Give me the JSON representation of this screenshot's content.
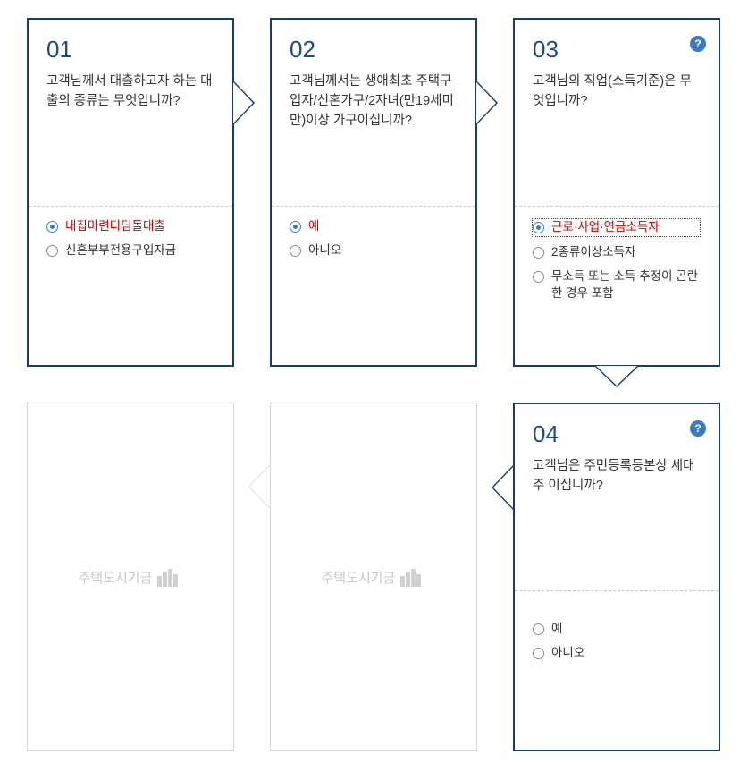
{
  "cards": [
    {
      "num": "01",
      "question": "고객님께서 대출하고자 하는 대출의 종류는 무엇입니까?",
      "options": [
        {
          "label": "내집마련디딤돌대출",
          "selected": true
        },
        {
          "label": "신혼부부전용구입자금",
          "selected": false
        }
      ]
    },
    {
      "num": "02",
      "question": "고객님께서는 생애최초 주택구입자/신혼가구/2자녀(만19세미만)이상 가구이십니까?",
      "options": [
        {
          "label": "예",
          "selected": true
        },
        {
          "label": "아니오",
          "selected": false
        }
      ]
    },
    {
      "num": "03",
      "question": "고객님의 직업(소득기준)은 무엇입니까?",
      "help": true,
      "options": [
        {
          "label": "근로·사업·연금소득자",
          "selected": true,
          "focused": true
        },
        {
          "label": "2종류이상소득자",
          "selected": false
        },
        {
          "label": "무소득 또는 소득 추정이 곤란한 경우 포함",
          "selected": false
        }
      ]
    },
    {
      "num": "04",
      "question": "고객님은 주민등록등본상 세대주 이십니까?",
      "help": true,
      "options": [
        {
          "label": "예",
          "selected": false
        },
        {
          "label": "아니오",
          "selected": false
        }
      ]
    }
  ],
  "placeholder_text": "주택도시기금"
}
